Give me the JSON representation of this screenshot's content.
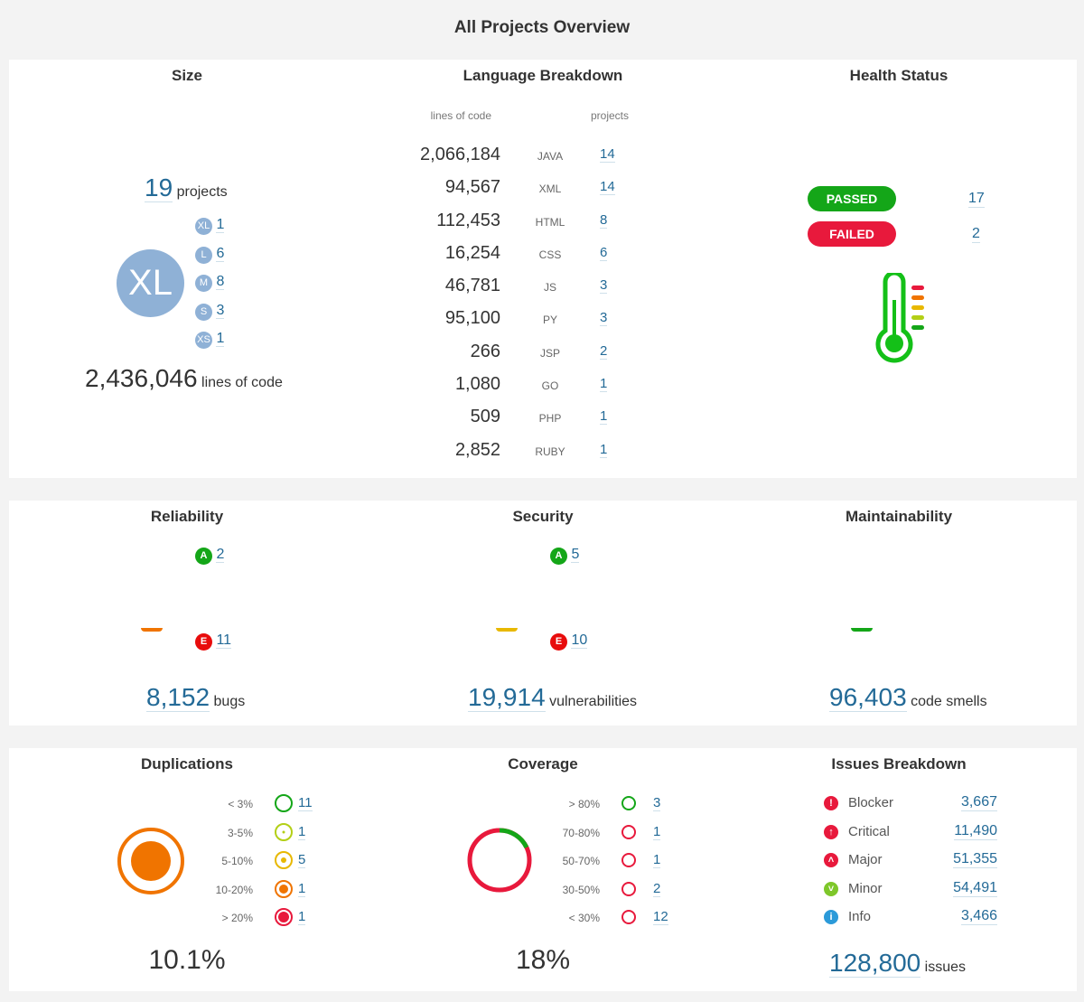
{
  "page": {
    "title": "All Projects Overview"
  },
  "size": {
    "title": "Size",
    "projects_count": "19",
    "projects_label": "projects",
    "big_badge": "XL",
    "buckets": [
      {
        "badge": "XL",
        "count": "1"
      },
      {
        "badge": "L",
        "count": "6"
      },
      {
        "badge": "M",
        "count": "8"
      },
      {
        "badge": "S",
        "count": "3"
      },
      {
        "badge": "XS",
        "count": "1"
      }
    ],
    "loc_count": "2,436,046",
    "loc_label": "lines of code"
  },
  "languages": {
    "title": "Language Breakdown",
    "col_loc": "lines of code",
    "col_projects": "projects",
    "rows": [
      {
        "loc": "2,066,184",
        "lang": "JAVA",
        "projects": "14"
      },
      {
        "loc": "94,567",
        "lang": "XML",
        "projects": "14"
      },
      {
        "loc": "112,453",
        "lang": "HTML",
        "projects": "8"
      },
      {
        "loc": "16,254",
        "lang": "CSS",
        "projects": "6"
      },
      {
        "loc": "46,781",
        "lang": "JS",
        "projects": "3"
      },
      {
        "loc": "95,100",
        "lang": "PY",
        "projects": "3"
      },
      {
        "loc": "266",
        "lang": "JSP",
        "projects": "2"
      },
      {
        "loc": "1,080",
        "lang": "GO",
        "projects": "1"
      },
      {
        "loc": "509",
        "lang": "PHP",
        "projects": "1"
      },
      {
        "loc": "2,852",
        "lang": "RUBY",
        "projects": "1"
      }
    ]
  },
  "health": {
    "title": "Health Status",
    "passed_label": "PASSED",
    "passed_count": "17",
    "failed_label": "FAILED",
    "failed_count": "2",
    "icon": "thermometer-icon",
    "colors": {
      "passed": "#14a618",
      "failed": "#e8193c"
    }
  },
  "reliability": {
    "title": "Reliability",
    "best_grade": "A",
    "best_count": "2",
    "worst_grade": "E",
    "worst_count": "11",
    "total": "8,152",
    "unit": "bugs"
  },
  "security": {
    "title": "Security",
    "best_grade": "A",
    "best_count": "5",
    "worst_grade": "E",
    "worst_count": "10",
    "total": "19,914",
    "unit": "vulnerabilities"
  },
  "maintainability": {
    "title": "Maintainability",
    "total": "96,403",
    "unit": "code smells"
  },
  "duplications": {
    "title": "Duplications",
    "rows": [
      {
        "label": "< 3%",
        "count": "11",
        "color": "#14a618"
      },
      {
        "label": "3-5%",
        "count": "1",
        "color": "#b3cf16"
      },
      {
        "label": "5-10%",
        "count": "5",
        "color": "#e8b800"
      },
      {
        "label": "10-20%",
        "count": "1",
        "color": "#f07400"
      },
      {
        "label": "> 20%",
        "count": "1",
        "color": "#e8193c"
      }
    ],
    "value": "10.1%"
  },
  "coverage": {
    "title": "Coverage",
    "rows": [
      {
        "label": "> 80%",
        "count": "3"
      },
      {
        "label": "70-80%",
        "count": "1"
      },
      {
        "label": "50-70%",
        "count": "1"
      },
      {
        "label": "30-50%",
        "count": "2"
      },
      {
        "label": "< 30%",
        "count": "12"
      }
    ],
    "value": "18%",
    "covered_fraction": 0.18
  },
  "issues": {
    "title": "Issues Breakdown",
    "rows": [
      {
        "label": "Blocker",
        "count": "3,667",
        "icon": "blocker-icon",
        "color": "#e8193c"
      },
      {
        "label": "Critical",
        "count": "11,490",
        "icon": "critical-icon",
        "color": "#e8193c"
      },
      {
        "label": "Major",
        "count": "51,355",
        "icon": "major-icon",
        "color": "#e8193c"
      },
      {
        "label": "Minor",
        "count": "54,491",
        "icon": "minor-icon",
        "color": "#7ec72a"
      },
      {
        "label": "Info",
        "count": "3,466",
        "icon": "info-icon",
        "color": "#2b9ad9"
      }
    ],
    "total": "128,800",
    "unit": "issues"
  }
}
